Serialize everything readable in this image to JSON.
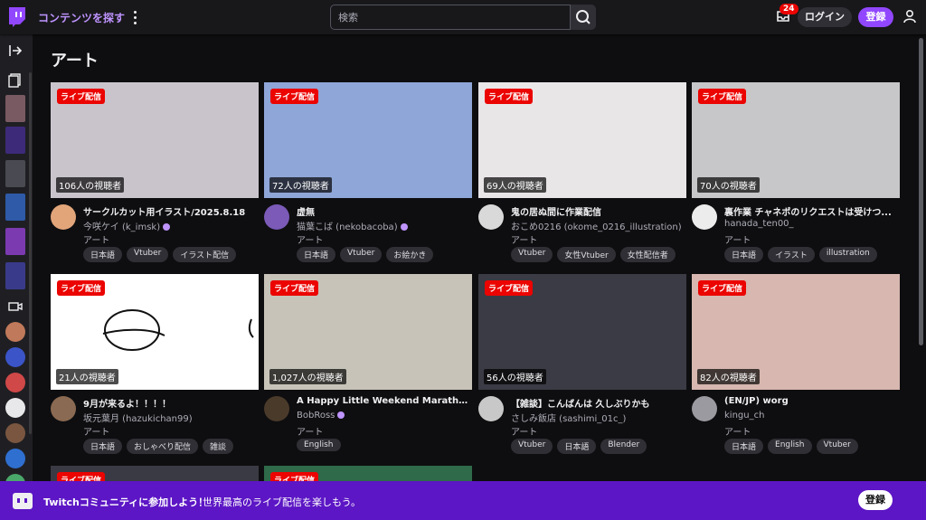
{
  "header": {
    "browse_label": "コンテンツを探す",
    "search_placeholder": "検索",
    "notification_count": "24",
    "login_label": "ログイン",
    "signup_label": "登録"
  },
  "page": {
    "title": "アート"
  },
  "live_label": "ライブ配信",
  "cards": [
    {
      "viewers": "106人の視聴者",
      "title": "サークルカット用イラスト/2025.8.18",
      "channel": "今咲ケイ (k_imsk)",
      "verified": true,
      "category": "アート",
      "tags": [
        "日本語",
        "Vtuber",
        "イラスト配信"
      ],
      "thumb_color": "#c9c4cc",
      "avatar_color": "#e2a57a"
    },
    {
      "viewers": "72人の視聴者",
      "title": "虚無",
      "channel": "猫葉こば (nekobacoba)",
      "verified": true,
      "category": "アート",
      "tags": [
        "日本語",
        "Vtuber",
        "お絵かき"
      ],
      "thumb_color": "#8fa6d8",
      "avatar_color": "#7b5ab8"
    },
    {
      "viewers": "69人の視聴者",
      "title": "鬼の居ぬ間に作業配信",
      "channel": "おこめ0216 (okome_0216_illustration)",
      "verified": false,
      "category": "アート",
      "tags": [
        "Vtuber",
        "女性Vtuber",
        "女性配信者"
      ],
      "thumb_color": "#e9e6e8",
      "avatar_color": "#d9d9d9"
    },
    {
      "viewers": "70人の視聴者",
      "title": "裏作業 チャネポのリクエストは受けつ...",
      "channel": "hanada_ten00_",
      "verified": false,
      "category": "アート",
      "tags": [
        "日本語",
        "イラスト",
        "illustration"
      ],
      "thumb_color": "#c7c7c9",
      "avatar_color": "#ececec"
    },
    {
      "viewers": "21人の視聴者",
      "title": "9月が来るよ！！！！",
      "channel": "坂元葉月 (hazukichan99)",
      "verified": false,
      "category": "アート",
      "tags": [
        "日本語",
        "おしゃべり配信",
        "雑談"
      ],
      "thumb_color": "#ffffff",
      "avatar_color": "#8a6a52"
    },
    {
      "viewers": "1,027人の視聴者",
      "title": "A Happy Little Weekend Marathon!",
      "channel": "BobRoss",
      "verified": true,
      "category": "アート",
      "tags": [
        "English"
      ],
      "thumb_color": "#c7c3b8",
      "avatar_color": "#4a3a2a"
    },
    {
      "viewers": "56人の視聴者",
      "title": "【雑談】こんばんは 久しぶりかも",
      "channel": "さしみ飯店 (sashimi_01c_)",
      "verified": false,
      "category": "アート",
      "tags": [
        "Vtuber",
        "日本語",
        "Blender"
      ],
      "thumb_color": "#3a3b44",
      "avatar_color": "#c8c8c8"
    },
    {
      "viewers": "82人の視聴者",
      "title": "(EN/JP) worg",
      "channel": "kingu_ch",
      "verified": false,
      "category": "アート",
      "tags": [
        "日本語",
        "English",
        "Vtuber"
      ],
      "thumb_color": "#d7b7b0",
      "avatar_color": "#9a9aa0"
    }
  ],
  "bottom_bar": {
    "text_bold": "Twitchコミュニティに参加しよう！",
    "text": "世界最高のライブ配信を楽しもう。",
    "button_label": "登録"
  },
  "colors": {
    "brand": "#9147ff",
    "live": "#eb0400",
    "banner": "#5c16c5"
  }
}
